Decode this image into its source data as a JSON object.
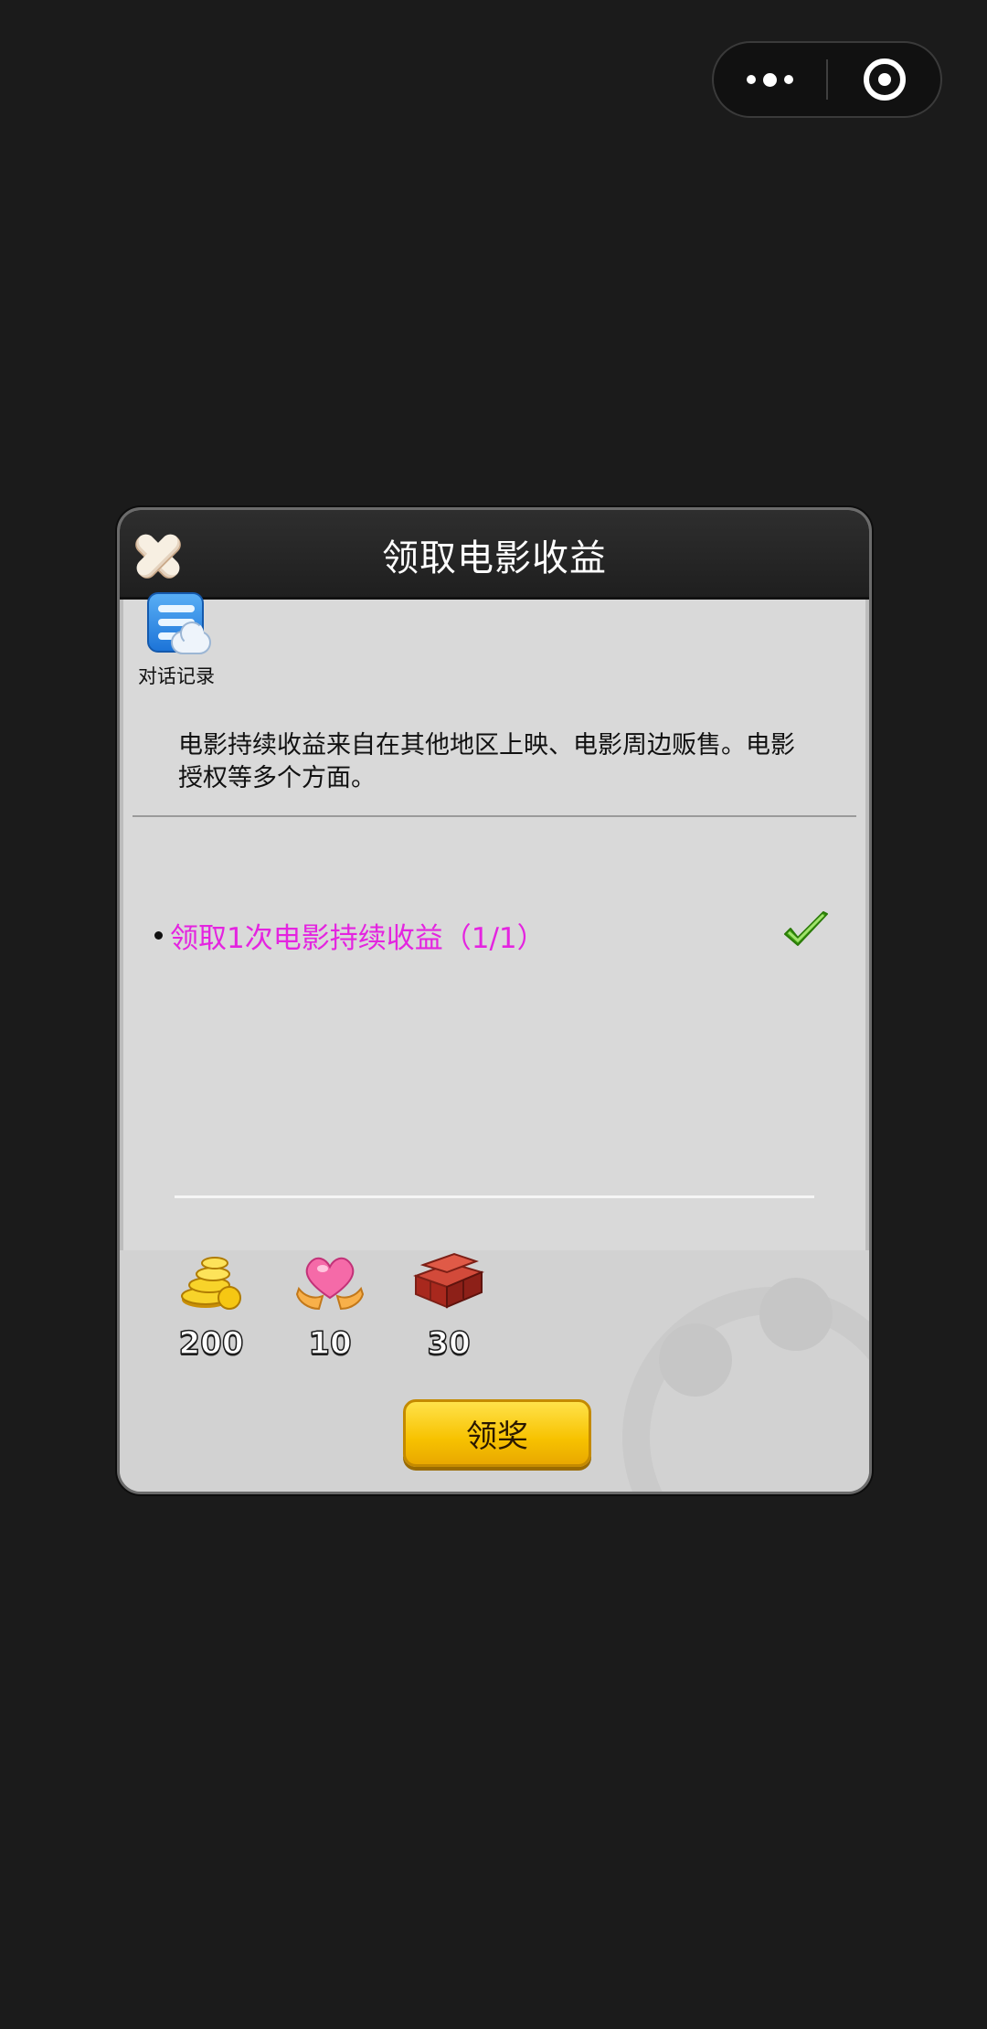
{
  "capsule": {
    "more_icon": "more-dots-icon",
    "close_icon": "target-circle-icon"
  },
  "dialog": {
    "title": "领取电影收益",
    "close_icon": "close-x-icon",
    "chatlog": {
      "icon": "chat-record-icon",
      "label": "对话记录"
    },
    "description": "电影持续收益来自在其他地区上映、电影周边贩售。电影授权等多个方面。",
    "task": {
      "text": "领取1次电影持续收益（1/1）",
      "status_icon": "green-check-icon",
      "color": "#e424e0"
    },
    "rewards": [
      {
        "icon": "gold-coins-icon",
        "value": "200"
      },
      {
        "icon": "heart-hands-icon",
        "value": "10"
      },
      {
        "icon": "bricks-icon",
        "value": "30"
      }
    ],
    "claim_button": "领奖"
  },
  "colors": {
    "background": "#1b1b1b",
    "dialog_body": "#d9d9d9",
    "header": "#262626",
    "button": "#f7c200",
    "task_text": "#e424e0",
    "check": "#4fb31c"
  }
}
